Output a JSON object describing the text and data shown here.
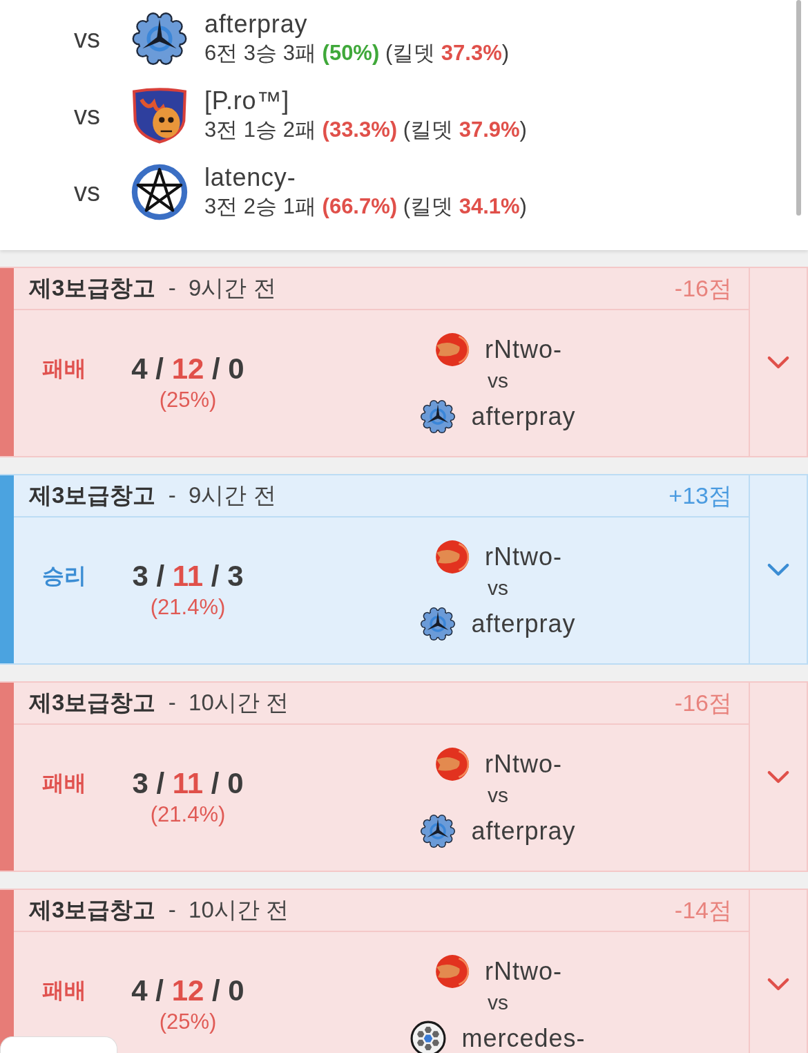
{
  "opponents": [
    {
      "vs": "vs",
      "kind": "cog",
      "name": "afterpray",
      "stats": "6전 3승 3패 **(50%)** (킬뎃 **37.3%**)",
      "color": "#3fa83a"
    },
    {
      "vs": "vs",
      "kind": "shield",
      "name": "[P.ro™]",
      "stats": "3전 1승 2패 **(33.3%)** (킬뎃 **37.9%**)",
      "color": "#e0504a"
    },
    {
      "vs": "vs",
      "kind": "pentagram",
      "name": "latency-",
      "stats": "3전 2승 1패 **(66.7%)** (킬뎃 **34.1%**)",
      "color": "#e0504a"
    }
  ],
  "matches": [
    {
      "won": false,
      "expanded": false,
      "title": "**제3보급창고**  -  9시간 전",
      "points": "-16점",
      "result": "패배",
      "kda": "4 / **12** / 0",
      "kill_share": "(25%)",
      "vs": "vs",
      "teams": [
        {
          "kind": "swirl",
          "name": "rNtwo-"
        },
        {
          "kind": "cog",
          "name": "afterpray"
        }
      ]
    },
    {
      "won": true,
      "expanded": false,
      "title": "**제3보급창고**  -  9시간 전",
      "points": "+13점",
      "result": "승리",
      "kda": "3 / **11** / 3",
      "kill_share": "(21.4%)",
      "vs": "vs",
      "teams": [
        {
          "kind": "swirl",
          "name": "rNtwo-"
        },
        {
          "kind": "cog",
          "name": "afterpray"
        }
      ]
    },
    {
      "won": false,
      "expanded": false,
      "title": "**제3보급창고**  -  10시간 전",
      "points": "-16점",
      "result": "패배",
      "kda": "3 / **11** / 0",
      "kill_share": "(21.4%)",
      "vs": "vs",
      "teams": [
        {
          "kind": "swirl",
          "name": "rNtwo-"
        },
        {
          "kind": "cog",
          "name": "afterpray"
        }
      ]
    },
    {
      "won": false,
      "expanded": false,
      "title": "**제3보급창고**  -  10시간 전",
      "points": "-14점",
      "result": "패배",
      "kda": "4 / **12** / 0",
      "kill_share": "(25%)",
      "vs": "vs",
      "teams": [
        {
          "kind": "swirl",
          "name": "rNtwo-"
        },
        {
          "kind": "hexball",
          "name": "mercedes-"
        }
      ]
    }
  ]
}
